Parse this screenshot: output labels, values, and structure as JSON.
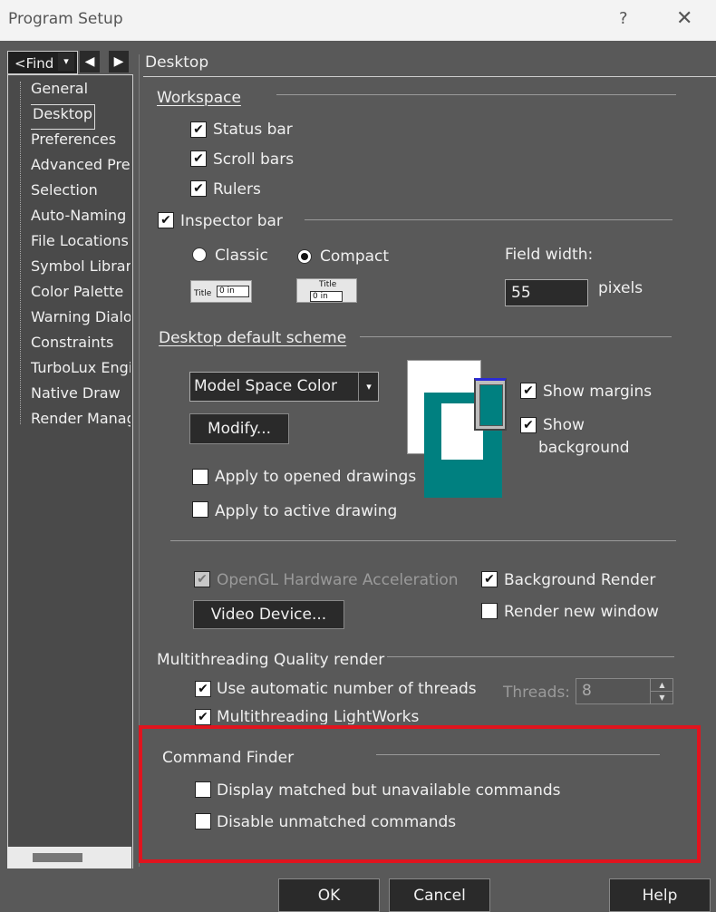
{
  "window": {
    "title": "Program Setup",
    "help_glyph": "?",
    "close_glyph": "✕"
  },
  "finder": {
    "value": "<Find",
    "drop": "▾",
    "prev": "◀",
    "next": "▶"
  },
  "tree": {
    "items": [
      "General",
      "Desktop",
      "Preferences",
      "Advanced Pre",
      "Selection",
      "Auto-Naming",
      "File Locations",
      "Symbol Librar",
      "Color Palette",
      "Warning Dialo",
      "Constraints",
      "TurboLux Engi",
      "Native Draw",
      "Render Manag"
    ],
    "selected": "Desktop"
  },
  "page": {
    "title": "Desktop"
  },
  "workspace": {
    "title": "Workspace",
    "status_bar": "Status bar",
    "scroll_bars": "Scroll bars",
    "rulers": "Rulers",
    "inspector_bar": "Inspector bar",
    "classic": "Classic",
    "compact": "Compact",
    "preview_title": "Title",
    "preview_value": "0 in",
    "field_width_label": "Field width:",
    "field_width_value": "55",
    "pixels": "pixels",
    "check": "✔"
  },
  "scheme": {
    "title": "Desktop default scheme",
    "selected": "Model Space Color",
    "modify": "Modify...",
    "show_margins": "Show margins",
    "show_background_1": "Show",
    "show_background_2": "background",
    "apply_opened": "Apply to opened drawings",
    "apply_active": "Apply to active drawing",
    "colors": {
      "page": "#ffffff",
      "teal": "#008080",
      "border": "#2b2bd6"
    }
  },
  "render": {
    "opengl": "OpenGL Hardware Acceleration",
    "video_device": "Video Device...",
    "background_render": "Background Render",
    "render_new_window": "Render new window"
  },
  "multithreading": {
    "title": "Multithreading Quality render",
    "auto_threads": "Use automatic number of threads",
    "lightworks": "Multithreading LightWorks",
    "threads_label": "Threads:",
    "threads_value": "8"
  },
  "command_finder": {
    "title": "Command Finder",
    "display_unavailable": "Display matched but unavailable commands",
    "disable_unmatched": "Disable unmatched commands",
    "highlight_color": "#e0141e"
  },
  "footer": {
    "ok": "OK",
    "cancel": "Cancel",
    "help": "Help"
  }
}
